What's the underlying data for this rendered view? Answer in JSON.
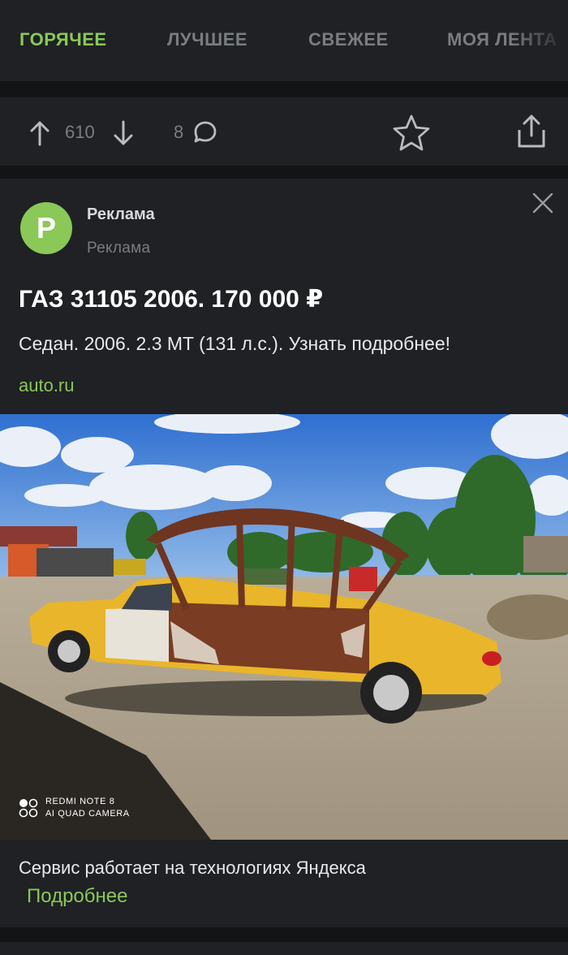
{
  "tabs": [
    {
      "label": "ГОРЯЧЕЕ",
      "active": true
    },
    {
      "label": "ЛУЧШЕЕ",
      "active": false
    },
    {
      "label": "СВЕЖЕЕ",
      "active": false
    },
    {
      "label": "МОЯ ЛЕНТА",
      "active": false
    }
  ],
  "post_actions": {
    "rating": "610",
    "comments": "8",
    "icons": [
      "arrow-up-icon",
      "arrow-down-icon",
      "comment-icon",
      "star-icon",
      "share-icon"
    ]
  },
  "ad": {
    "avatar_letter": "P",
    "author": "Реклама",
    "sub_label": "Реклама",
    "title": "ГАЗ 31105 2006. 170 000 ₽",
    "description": "Седан. 2006. 2.3 MT (131 л.с.). Узнать подробнее!",
    "link_text": "auto.ru",
    "photo_watermark_line1": "REDMI NOTE 8",
    "photo_watermark_line2": "AI QUAD CAMERA",
    "footer_text": "Сервис работает на технологиях Яндекса",
    "footer_link": "Подробнее"
  },
  "colors": {
    "accent": "#8ac858",
    "background": "#131416",
    "card": "#1f2124",
    "muted": "#7a7d80"
  }
}
